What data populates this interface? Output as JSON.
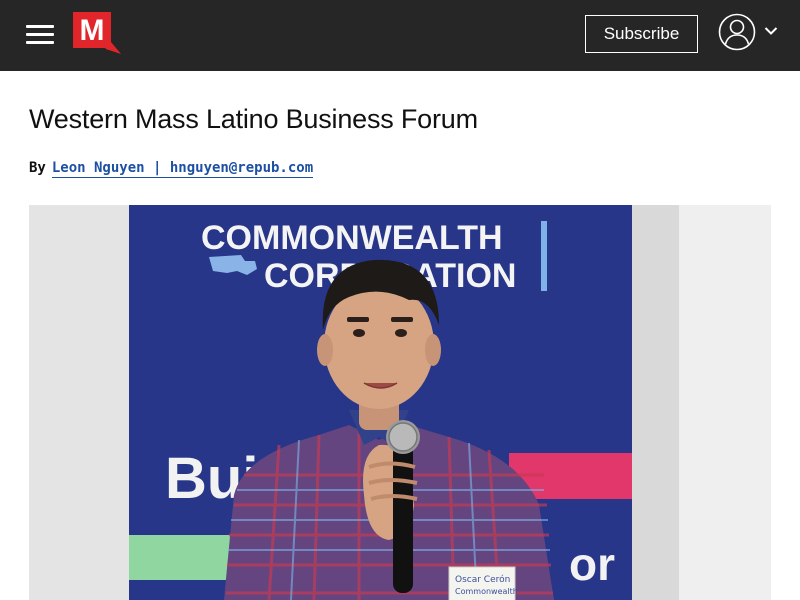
{
  "header": {
    "logo_letter": "M",
    "subscribe_label": "Subscribe",
    "colors": {
      "bar": "#262626",
      "logo_red": "#e0262b"
    }
  },
  "article": {
    "title": "Western Mass Latino Business Forum",
    "byline_prefix": "By",
    "author_link": "Leon Nguyen | hnguyen@repub.com"
  },
  "photo": {
    "banner_line1": "COMMONWEALTH",
    "banner_line2": "CORPORATION",
    "banner_word_left": "Bui",
    "banner_word_right": "or",
    "name_tag": "Oscar Cerón",
    "name_tag_org": "Commonwealth",
    "colors": {
      "banner_blue": "#2a3a8f",
      "accent_pink": "#e2376b",
      "accent_green": "#8fd6a0"
    }
  }
}
